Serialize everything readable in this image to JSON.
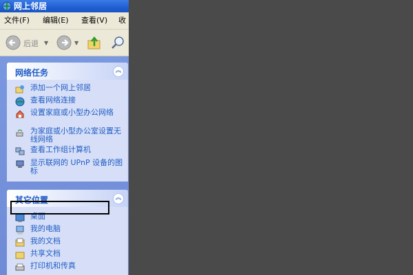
{
  "window": {
    "title": "网上邻居"
  },
  "menu": [
    "文件(F)",
    "编辑(E)",
    "查看(V)",
    "收"
  ],
  "toolbar": {
    "back_label": "后退"
  },
  "network_tasks": {
    "title": "网络任务",
    "items": [
      {
        "label": "添加一个网上邻居",
        "icon": "add-network-place-icon"
      },
      {
        "label": "查看网络连接",
        "icon": "network-connections-icon"
      },
      {
        "label": "设置家庭或小型办公网络",
        "icon": "home-network-icon"
      },
      {
        "label": "为家庭或小型办公室设置无线网络",
        "icon": "wireless-network-icon"
      },
      {
        "label": "查看工作组计算机",
        "icon": "workgroup-computers-icon"
      },
      {
        "label": "显示联网的 UPnP 设备的图标",
        "icon": "upnp-devices-icon"
      }
    ]
  },
  "other_places": {
    "title": "其它位置",
    "items": [
      {
        "label": "桌面",
        "icon": "desktop-icon"
      },
      {
        "label": "我的电脑",
        "icon": "my-computer-icon"
      },
      {
        "label": "我的文档",
        "icon": "my-documents-icon"
      },
      {
        "label": "共享文档",
        "icon": "shared-documents-icon"
      },
      {
        "label": "打印机和传真",
        "icon": "printers-fax-icon"
      }
    ]
  },
  "colors": {
    "title_bar": "#245edb",
    "link": "#215dc6",
    "task_pane": "#6f8bd6",
    "background": "#4a4a4a"
  }
}
